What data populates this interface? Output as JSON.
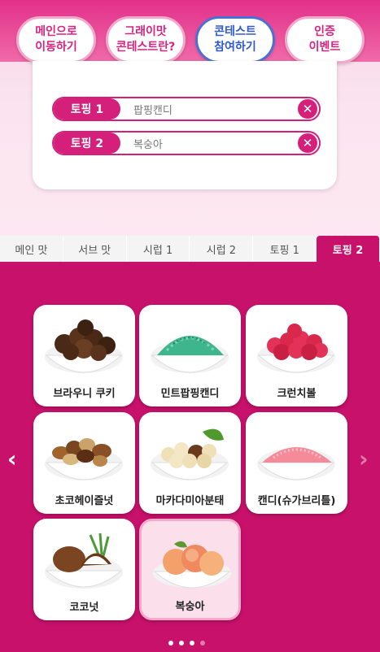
{
  "nav": {
    "pills": [
      {
        "line1": "메인으로",
        "line2": "이동하기"
      },
      {
        "line1": "그래이맛",
        "line2": "콘테스트란?"
      },
      {
        "line1": "콘테스트",
        "line2": "참여하기"
      },
      {
        "line1": "인증",
        "line2": "이벤트"
      }
    ]
  },
  "toppings": [
    {
      "tag": "토핑 1",
      "value": "팝핑캔디",
      "remove": "✕"
    },
    {
      "tag": "토핑 2",
      "value": "복숭아",
      "remove": "✕"
    }
  ],
  "tabs": [
    "메인 맛",
    "서브 맛",
    "시럽 1",
    "시럽 2",
    "토핑 1",
    "토핑 2"
  ],
  "active_tab": "토핑 2",
  "items": [
    {
      "label": "브라우니 쿠키",
      "icon": "brownie-cookie-icon"
    },
    {
      "label": "민트팝핑캔디",
      "icon": "mint-popping-candy-icon"
    },
    {
      "label": "크런치볼",
      "icon": "crunch-ball-icon"
    },
    {
      "label": "초코헤이즐넛",
      "icon": "choco-hazelnut-icon"
    },
    {
      "label": "마카다미아분태",
      "icon": "macadamia-icon"
    },
    {
      "label": "캔디(슈가브리틀)",
      "icon": "sugar-brittle-icon"
    },
    {
      "label": "코코넛",
      "icon": "coconut-icon"
    },
    {
      "label": "복숭아",
      "icon": "peach-icon"
    }
  ],
  "selected_item": "복숭아",
  "pagination": {
    "prev": "‹",
    "next": "›",
    "pages": 4,
    "current": 1
  },
  "colors": {
    "accent": "#c8116b",
    "tag": "#d4207b",
    "active_pill": "#2f59cf"
  }
}
